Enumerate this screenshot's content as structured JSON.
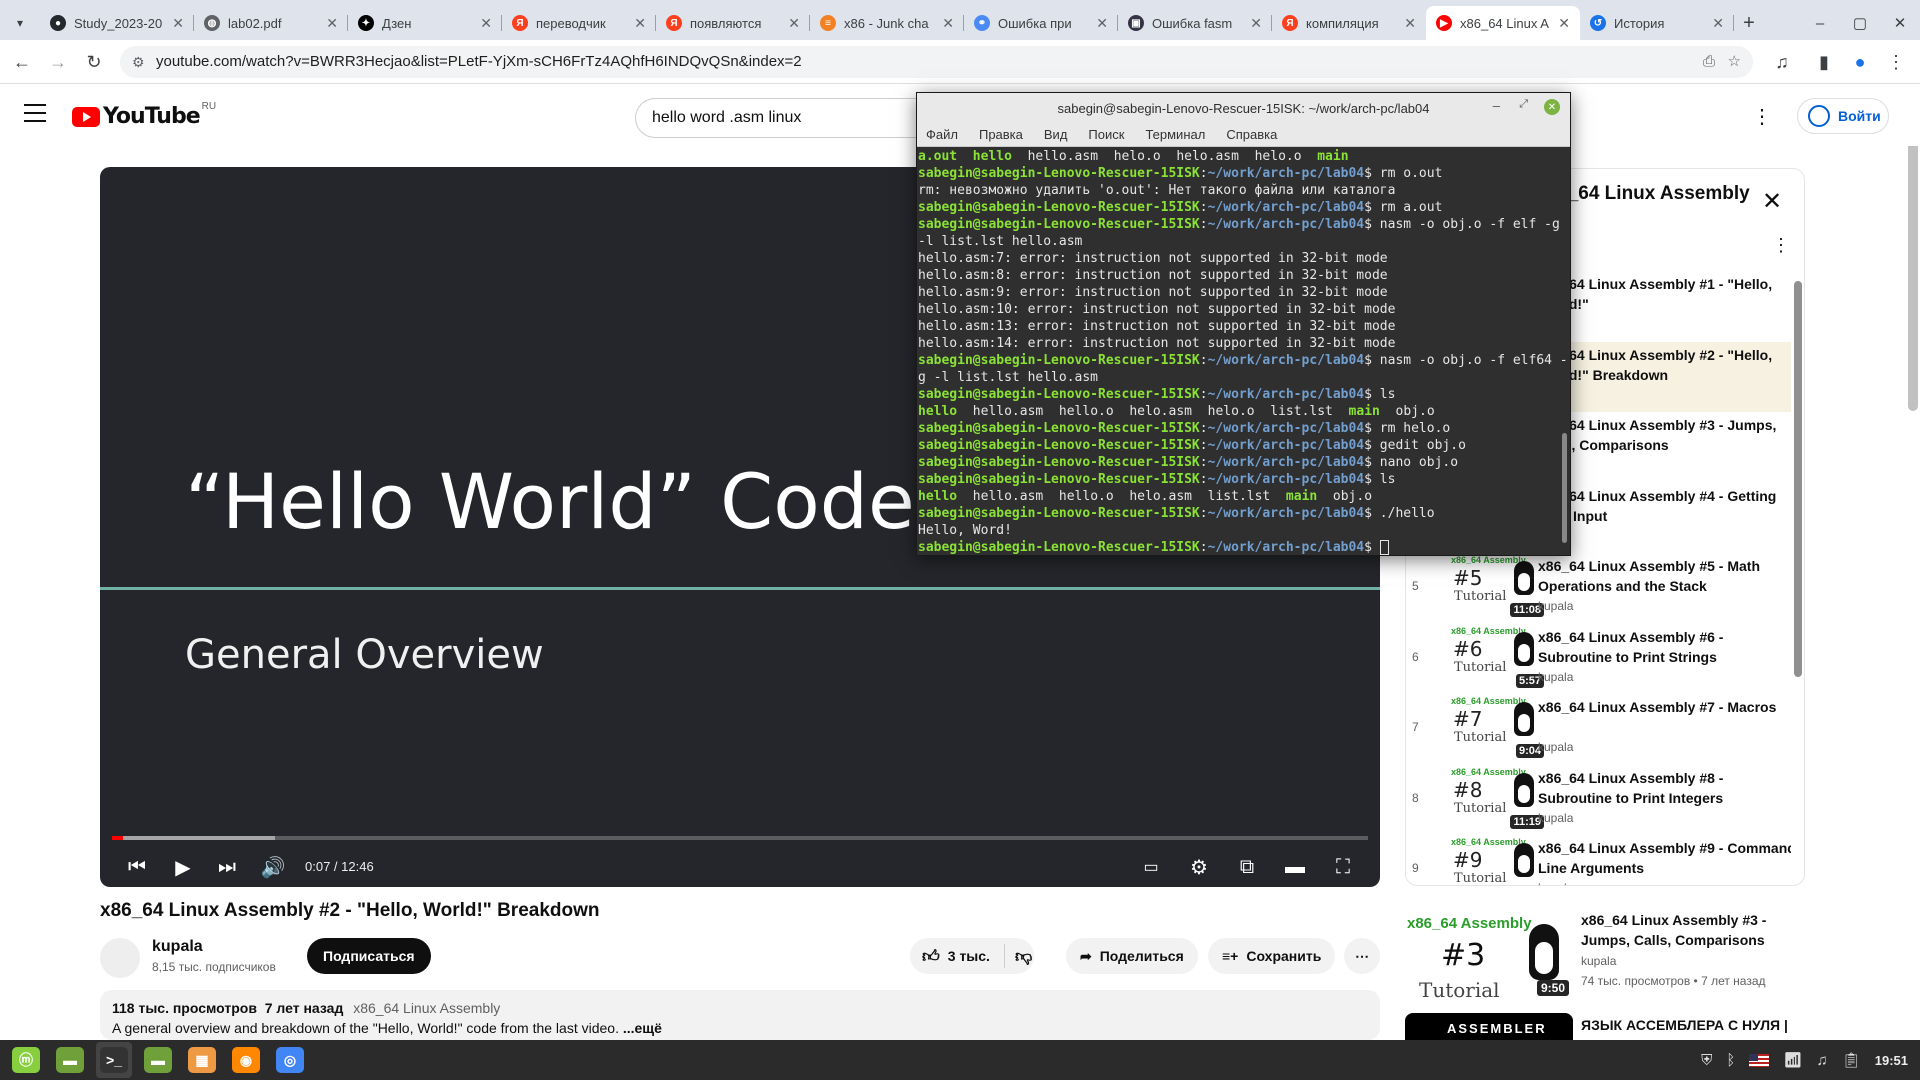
{
  "browser": {
    "tabs": [
      {
        "label": "Study_2023-20",
        "icon": "github-icon",
        "color": "#24292e",
        "glyph": "●"
      },
      {
        "label": "lab02.pdf",
        "icon": "globe-icon",
        "color": "#5f6368",
        "glyph": "◍"
      },
      {
        "label": "Дзен",
        "icon": "dzen-icon",
        "color": "#000000",
        "glyph": "✦"
      },
      {
        "label": "переводчик",
        "icon": "yandex-icon",
        "color": "#fc3f1d",
        "glyph": "Я"
      },
      {
        "label": "появляются",
        "icon": "yandex-icon",
        "color": "#fc3f1d",
        "glyph": "Я"
      },
      {
        "label": "x86 - Junk cha",
        "icon": "stackoverflow-icon",
        "color": "#f48024",
        "glyph": "≡"
      },
      {
        "label": "Ошибка при",
        "icon": "network-icon",
        "color": "#4c8bf5",
        "glyph": "⚭"
      },
      {
        "label": "Ошибка fasm",
        "icon": "site-icon",
        "color": "#334",
        "glyph": "▣"
      },
      {
        "label": "компиляция",
        "icon": "yandex-icon",
        "color": "#fc3f1d",
        "glyph": "Я"
      },
      {
        "label": "x86_64 Linux A",
        "icon": "youtube-icon",
        "color": "#ff0000",
        "glyph": "▶"
      },
      {
        "label": "История",
        "icon": "history-icon",
        "color": "#1a73e8",
        "glyph": "↺"
      }
    ],
    "url": "youtube.com/watch?v=BWRR3Hecjao&list=PLetF-YjXm-sCH6FrTz4AQhfH6INDQvQSn&index=2"
  },
  "youtube": {
    "logo_text": "YouTube",
    "region": "RU",
    "search_value": "hello word .asm linux",
    "signin_label": "Войти",
    "video": {
      "slide_title": "“Hello World” Code",
      "slide_subtitle": "General Overview",
      "time_display": "0:07 / 12:46",
      "played_fraction": 0.009,
      "buffered_fraction": 0.13,
      "title": "x86_64 Linux Assembly #2 - \"Hello, World!\" Breakdown",
      "channel": "kupala",
      "subscribers": "8,15 тыс. подписчиков",
      "subscribe_label": "Подписаться",
      "likes": "3 тыс.",
      "share_label": "Поделиться",
      "save_label": "Сохранить",
      "views_line": "118 тыс. просмотров  7 лет назад",
      "playlist_link": "x86_64 Linux Assembly",
      "description": "A general overview and breakdown of the \"Hello, World!\" code from the last video.",
      "more_label": "...ещё"
    },
    "playlist": {
      "title": "x86_64 Linux Assembly",
      "items": [
        {
          "index": "",
          "num": "#1",
          "duration": "",
          "title": "x86_64 Linux Assembly #1 - \"Hello, World!\"",
          "author": ""
        },
        {
          "index": "",
          "num": "#2",
          "duration": "",
          "title": "x86_64 Linux Assembly #2 - \"Hello, World!\" Breakdown",
          "author": ""
        },
        {
          "index": "",
          "num": "#3",
          "duration": "",
          "title": "x86_64 Linux Assembly #3 - Jumps, Calls, Comparisons",
          "author": ""
        },
        {
          "index": "",
          "num": "#4",
          "duration": "",
          "title": "x86_64 Linux Assembly #4 - Getting User Input",
          "author": ""
        },
        {
          "index": "5",
          "num": "#5",
          "duration": "11:08",
          "title": "x86_64 Linux Assembly #5 - Math Operations and the Stack",
          "author": "kupala"
        },
        {
          "index": "6",
          "num": "#6",
          "duration": "5:57",
          "title": "x86_64 Linux Assembly #6 - Subroutine to Print Strings",
          "author": "kupala"
        },
        {
          "index": "7",
          "num": "#7",
          "duration": "9:04",
          "title": "x86_64 Linux Assembly #7 - Macros",
          "author": "kupala"
        },
        {
          "index": "8",
          "num": "#8",
          "duration": "11:19",
          "title": "x86_64 Linux Assembly #8 - Subroutine to Print Integers",
          "author": "kupala"
        },
        {
          "index": "9",
          "num": "#9",
          "duration": "6:20",
          "title": "x86_64 Linux Assembly #9 - Command Line Arguments",
          "author": "kupala"
        }
      ],
      "assembly_tag": "x86_64 Assembly",
      "tutorial_tag": "Tutorial"
    },
    "recommended": [
      {
        "num": "#3",
        "duration": "9:50",
        "title": "x86_64 Linux Assembly #3 - Jumps, Calls, Comparisons",
        "author": "kupala",
        "meta": "74 тыс. просмотров • 7 лет назад"
      },
      {
        "badge": "ASSEMBLER",
        "title": "ЯЗЫК АССЕМБЛЕРА С НУЛЯ | #1 НАЧАЛО"
      }
    ]
  },
  "terminal": {
    "title": "sabegin@sabegin-Lenovo-Rescuer-15ISK: ~/work/arch-pc/lab04",
    "menu": [
      "Файл",
      "Правка",
      "Вид",
      "Поиск",
      "Терминал",
      "Справка"
    ],
    "user_host": "sabegin@sabegin-Lenovo-Rescuer-15ISK",
    "path": "~/work/arch-pc/lab04",
    "lines": [
      {
        "t": "listing",
        "items": [
          {
            "c": "g",
            "v": "a.out"
          },
          {
            "c": "g",
            "v": "hello"
          },
          {
            "c": "",
            "v": "hello.asm"
          },
          {
            "c": "",
            "v": "helo.o"
          },
          {
            "c": "",
            "v": "helo.asm"
          },
          {
            "c": "",
            "v": "helo.o"
          },
          {
            "c": "g",
            "v": "main"
          }
        ]
      },
      {
        "t": "prompt",
        "cmd": "rm o.out"
      },
      {
        "t": "out",
        "v": "rm: невозможно удалить 'o.out': Нет такого файла или каталога"
      },
      {
        "t": "prompt",
        "cmd": "rm a.out"
      },
      {
        "t": "prompt",
        "cmd": "nasm -o obj.o -f elf -g -l list.lst hello.asm"
      },
      {
        "t": "out",
        "v": "hello.asm:7: error: instruction not supported in 32-bit mode"
      },
      {
        "t": "out",
        "v": "hello.asm:8: error: instruction not supported in 32-bit mode"
      },
      {
        "t": "out",
        "v": "hello.asm:9: error: instruction not supported in 32-bit mode"
      },
      {
        "t": "out",
        "v": "hello.asm:10: error: instruction not supported in 32-bit mode"
      },
      {
        "t": "out",
        "v": "hello.asm:13: error: instruction not supported in 32-bit mode"
      },
      {
        "t": "out",
        "v": "hello.asm:14: error: instruction not supported in 32-bit mode"
      },
      {
        "t": "prompt",
        "cmd": "nasm -o obj.o -f elf64 -g -l list.lst hello.asm"
      },
      {
        "t": "prompt",
        "cmd": "ls"
      },
      {
        "t": "listing",
        "items": [
          {
            "c": "g",
            "v": "hello"
          },
          {
            "c": "",
            "v": "hello.asm"
          },
          {
            "c": "",
            "v": "hello.o"
          },
          {
            "c": "",
            "v": "helo.asm"
          },
          {
            "c": "",
            "v": "helo.o"
          },
          {
            "c": "",
            "v": "list.lst"
          },
          {
            "c": "g",
            "v": "main"
          },
          {
            "c": "",
            "v": "obj.o"
          }
        ]
      },
      {
        "t": "prompt",
        "cmd": "rm helo.o"
      },
      {
        "t": "prompt",
        "cmd": "gedit obj.o"
      },
      {
        "t": "prompt",
        "cmd": "nano obj.o"
      },
      {
        "t": "prompt",
        "cmd": "ls"
      },
      {
        "t": "listing",
        "items": [
          {
            "c": "g",
            "v": "hello"
          },
          {
            "c": "",
            "v": "hello.asm"
          },
          {
            "c": "",
            "v": "hello.o"
          },
          {
            "c": "",
            "v": "helo.asm"
          },
          {
            "c": "",
            "v": "list.lst"
          },
          {
            "c": "g",
            "v": "main"
          },
          {
            "c": "",
            "v": "obj.o"
          }
        ]
      },
      {
        "t": "prompt",
        "cmd": "./hello"
      },
      {
        "t": "out",
        "v": "Hello, Word!"
      },
      {
        "t": "prompt",
        "cmd": "",
        "cursor": true
      }
    ]
  },
  "taskbar": {
    "clock": "19:51",
    "apps": [
      "mint-menu-icon",
      "files-icon",
      "terminal-icon",
      "folder-icon",
      "software-icon",
      "firefox-icon",
      "chrome-icon"
    ]
  }
}
